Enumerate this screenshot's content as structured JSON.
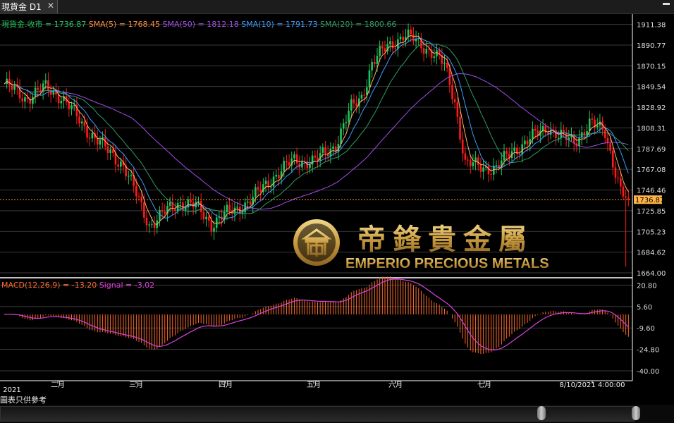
{
  "window": {
    "tab_title": "現貨金 D1",
    "close_glyph": "✕"
  },
  "header_legend": [
    {
      "text": "現貨金.收市 = 1736.87",
      "color": "#22c55e"
    },
    {
      "text": "SMA(5) = 1768.45",
      "color": "#ff8c3a"
    },
    {
      "text": "SMA(50) = 1812.18",
      "color": "#a04de8"
    },
    {
      "text": "SMA(10) = 1791.73",
      "color": "#3b9cff"
    },
    {
      "text": "SMA(20) = 1800.66",
      "color": "#2e9d63"
    }
  ],
  "macd_legend": [
    {
      "text": "MACD(12,26,9) = -13.20",
      "color": "#ff6a2a"
    },
    {
      "text": "Signal = -3.02",
      "color": "#e040e0"
    }
  ],
  "logo": {
    "chinese": "帝鋒貴金屬",
    "english": "EMPERIO PRECIOUS METALS"
  },
  "disclaimer": "圖表只供參考",
  "current_price_label": "1736.87",
  "date_label": "8/10/2021 4:00:00",
  "colors": {
    "up": "#22c55e",
    "down": "#ff1a1a",
    "sma5": "#ffb070",
    "sma10": "#3b9cff",
    "sma20": "#2e9d63",
    "sma50": "#a04de8",
    "macd_hist": "#ff6a2a",
    "signal": "#e040e0",
    "gold": "#c8a04a"
  },
  "chart_data": [
    {
      "type": "candlestick",
      "title": "現貨金 D1",
      "y_axis_ticks": [
        1911.38,
        1890.77,
        1870.15,
        1849.54,
        1828.92,
        1808.31,
        1787.69,
        1767.08,
        1746.46,
        1725.85,
        1705.23,
        1684.62,
        1664.0
      ],
      "ylim": [
        1664.0,
        1916.0
      ],
      "x_axis_labels": [
        "2021",
        "二月",
        "三月",
        "四月",
        "五月",
        "六月",
        "七月",
        "8/10/2021 4:00:00"
      ],
      "grid": true,
      "close_anchors": [
        [
          0,
          1852
        ],
        [
          8,
          1838
        ],
        [
          16,
          1848
        ],
        [
          22,
          1840
        ],
        [
          30,
          1812
        ],
        [
          40,
          1785
        ],
        [
          46,
          1772
        ],
        [
          52,
          1735
        ],
        [
          56,
          1712
        ],
        [
          60,
          1720
        ],
        [
          68,
          1735
        ],
        [
          74,
          1730
        ],
        [
          80,
          1713
        ],
        [
          84,
          1720
        ],
        [
          90,
          1728
        ],
        [
          96,
          1738
        ],
        [
          104,
          1760
        ],
        [
          112,
          1776
        ],
        [
          120,
          1775
        ],
        [
          128,
          1792
        ],
        [
          134,
          1828
        ],
        [
          138,
          1840
        ],
        [
          142,
          1872
        ],
        [
          148,
          1890
        ],
        [
          154,
          1900
        ],
        [
          158,
          1896
        ],
        [
          162,
          1890
        ],
        [
          166,
          1882
        ],
        [
          170,
          1870
        ],
        [
          174,
          1835
        ],
        [
          178,
          1772
        ],
        [
          184,
          1770
        ],
        [
          190,
          1768
        ],
        [
          196,
          1785
        ],
        [
          202,
          1795
        ],
        [
          210,
          1810
        ],
        [
          214,
          1800
        ],
        [
          220,
          1795
        ],
        [
          226,
          1812
        ],
        [
          232,
          1805
        ],
        [
          236,
          1765
        ],
        [
          238,
          1745
        ],
        [
          240,
          1736.87
        ]
      ],
      "series": [
        {
          "name": "現貨金.收市",
          "last": 1736.87
        },
        {
          "name": "SMA(5)",
          "last": 1768.45
        },
        {
          "name": "SMA(10)",
          "last": 1791.73
        },
        {
          "name": "SMA(20)",
          "last": 1800.66
        },
        {
          "name": "SMA(50)",
          "last": 1812.18
        }
      ]
    },
    {
      "type": "bar",
      "title": "MACD(12,26,9)",
      "y_axis_ticks": [
        20.8,
        5.6,
        -9.6,
        -24.8,
        -40.0
      ],
      "ylim": [
        -42,
        25
      ],
      "series": [
        {
          "name": "MACD(12,26,9)",
          "last": -13.2
        },
        {
          "name": "Signal",
          "last": -3.02
        }
      ]
    }
  ]
}
